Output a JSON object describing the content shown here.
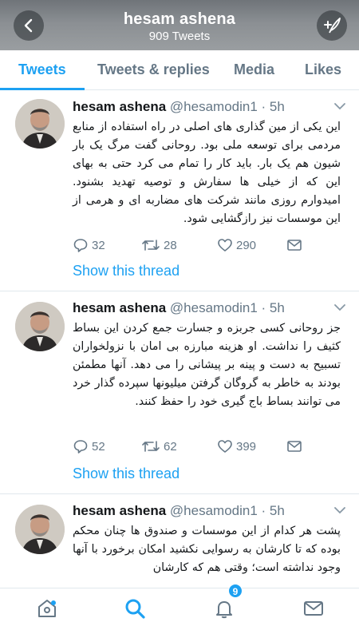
{
  "header": {
    "title": "hesam ashena",
    "subtitle": "909 Tweets",
    "back_icon": "back-arrow-icon",
    "compose_icon": "compose-icon"
  },
  "tabs": [
    {
      "label": "Tweets",
      "active": true
    },
    {
      "label": "Tweets & replies",
      "active": false
    },
    {
      "label": "Media",
      "active": false
    },
    {
      "label": "Likes",
      "active": false
    }
  ],
  "tweets": [
    {
      "name": "hesam ashena",
      "handle": "@hesamodin1",
      "time": "· 5h",
      "text": "این یکی از مین گذاری های اصلی در راه استفاده از منابع مردمی برای توسعه ملی بود. روحانی گفت مرگ یک بار شیون هم یک بار. باید کار را تمام می کرد حتی به بهای این که از خیلی ها سفارش و توصیه تهدید بشنود. امیدوارم روزی مانند شرکت های مضاربه ای و هرمی از این موسسات نیز رازگشایی شود.",
      "replies": "32",
      "retweets": "28",
      "likes": "290",
      "show_thread": "Show this thread"
    },
    {
      "name": "hesam ashena",
      "handle": "@hesamodin1",
      "time": "· 5h",
      "text": "جز روحانی کسی جربزه و جسارت جمع کردن این بساط کثیف را نداشت. او هزینه مبارزه بی امان با نزولخواران تسبیح به دست و پینه بر پیشانی را می دهد. آنها مطمئن بودند به خاطر به گروگان گرفتن میلیونها سپرده گذار خرد می توانند بساط باج گیری خود را حفظ کنند.",
      "replies": "52",
      "retweets": "62",
      "likes": "399",
      "show_thread": "Show this thread"
    },
    {
      "name": "hesam ashena",
      "handle": "@hesamodin1",
      "time": "· 5h",
      "text": "پشت هر کدام از این موسسات و صندوق ها چنان محکم بوده که تا کارشان به رسوایی نکشید امکان برخورد با آنها وجود نداشته است؛ وقتی هم که کارشان"
    }
  ],
  "bottom_nav": {
    "home_icon": "home-icon",
    "search_icon": "search-icon",
    "notifications_icon": "bell-icon",
    "notifications_badge": "9",
    "messages_icon": "mail-icon"
  },
  "colors": {
    "accent": "#1da1f2",
    "muted": "#657786",
    "text": "#14171a",
    "divider": "#e1e8ed"
  }
}
